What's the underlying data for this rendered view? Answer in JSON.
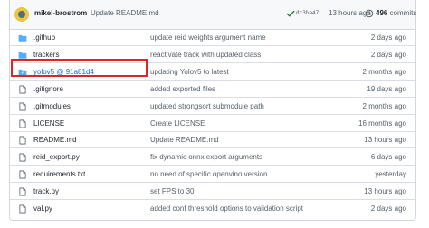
{
  "commit": {
    "author": "mikel-brostrom",
    "message": "Update README.md",
    "sha": "dc3ba47",
    "time": "13 hours ago",
    "commits_count": "496",
    "commits_label": "commits"
  },
  "files": [
    {
      "name": ".github",
      "type": "folder",
      "message": "update reid weights argument name",
      "age": "2 days ago"
    },
    {
      "name": "trackers",
      "type": "folder",
      "message": "reactivate track with updated class",
      "age": "2 days ago"
    },
    {
      "name": "yolov5 @ 91a81d4",
      "type": "submodule",
      "message": "updating Yolov5 to latest",
      "age": "2 months ago"
    },
    {
      "name": ".gitignore",
      "type": "file",
      "message": "added exported files",
      "age": "19 days ago"
    },
    {
      "name": ".gitmodules",
      "type": "file",
      "message": "updated strongsort submodule path",
      "age": "2 months ago"
    },
    {
      "name": "LICENSE",
      "type": "file",
      "message": "Create LICENSE",
      "age": "16 months ago"
    },
    {
      "name": "README.md",
      "type": "file",
      "message": "Update README.md",
      "age": "13 hours ago"
    },
    {
      "name": "reid_export.py",
      "type": "file",
      "message": "fix dynamic onnx export arguments",
      "age": "6 days ago"
    },
    {
      "name": "requirements.txt",
      "type": "file",
      "message": "no need of specific openvino version",
      "age": "yesterday"
    },
    {
      "name": "track.py",
      "type": "file",
      "message": "set FPS to 30",
      "age": "13 hours ago"
    },
    {
      "name": "val.py",
      "type": "file",
      "message": "added conf threshold options to validation script",
      "age": "2 days ago"
    }
  ],
  "colors": {
    "folder": "#54aeff",
    "file_icon": "#57606a",
    "link": "#0969da",
    "success": "#1a7f37",
    "highlight": "#d62828"
  }
}
